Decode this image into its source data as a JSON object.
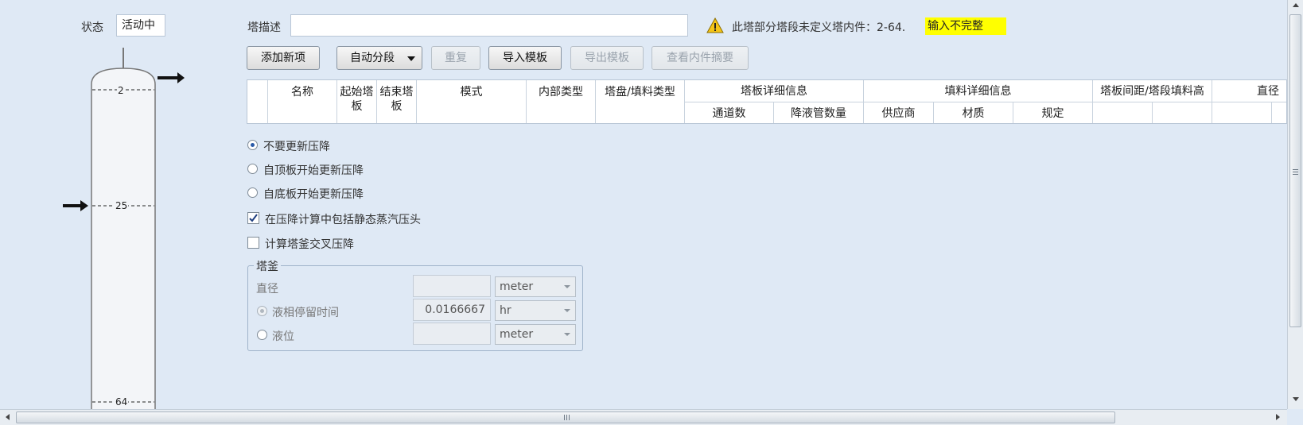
{
  "status": {
    "label": "状态",
    "value": "活动中"
  },
  "column": {
    "stage_labels": [
      "2",
      "25",
      "64"
    ]
  },
  "description": {
    "label": "塔描述",
    "value": ""
  },
  "warning": {
    "icon": "warning-icon",
    "message": "此塔部分塔段未定义塔内件：2-64.",
    "badge": "输入不完整",
    "badge_color": "#ffff00"
  },
  "toolbar": {
    "add_label": "添加新项",
    "auto_label": "自动分段",
    "repeat_label": "重复",
    "import_label": "导入模板",
    "export_label": "导出模板",
    "view_label": "查看内件摘要"
  },
  "grid": {
    "headers": {
      "name": "名称",
      "start_l1": "起始塔",
      "start_l2": "板",
      "end_l1": "结束塔",
      "end_l2": "板",
      "mode": "模式",
      "internal_type": "内部类型",
      "tray_type": "塔盘/填料类型",
      "tray_detail": "塔板详细信息",
      "passes": "通道数",
      "downcomers": "降液管数量",
      "packing_detail": "填料详细信息",
      "vendor": "供应商",
      "material": "材质",
      "spec": "规定",
      "spacing": "塔板间距/塔段填料高",
      "diameter": "直径"
    }
  },
  "pressure_drop": {
    "options": [
      "不要更新压降",
      "自顶板开始更新压降",
      "自底板开始更新压降"
    ],
    "selected_index": 0,
    "include_static_head_label": "在压降计算中包括静态蒸汽压头",
    "include_static_head_checked": true,
    "sump_cross_label": "计算塔釜交叉压降",
    "sump_cross_checked": false
  },
  "sump": {
    "title": "塔釜",
    "diameter_label": "直径",
    "diameter_value": "",
    "diameter_unit": "meter",
    "residence_label": "液相停留时间",
    "residence_value": "0.0166667",
    "residence_unit": "hr",
    "level_label": "液位",
    "level_value": "",
    "level_unit": "meter"
  }
}
